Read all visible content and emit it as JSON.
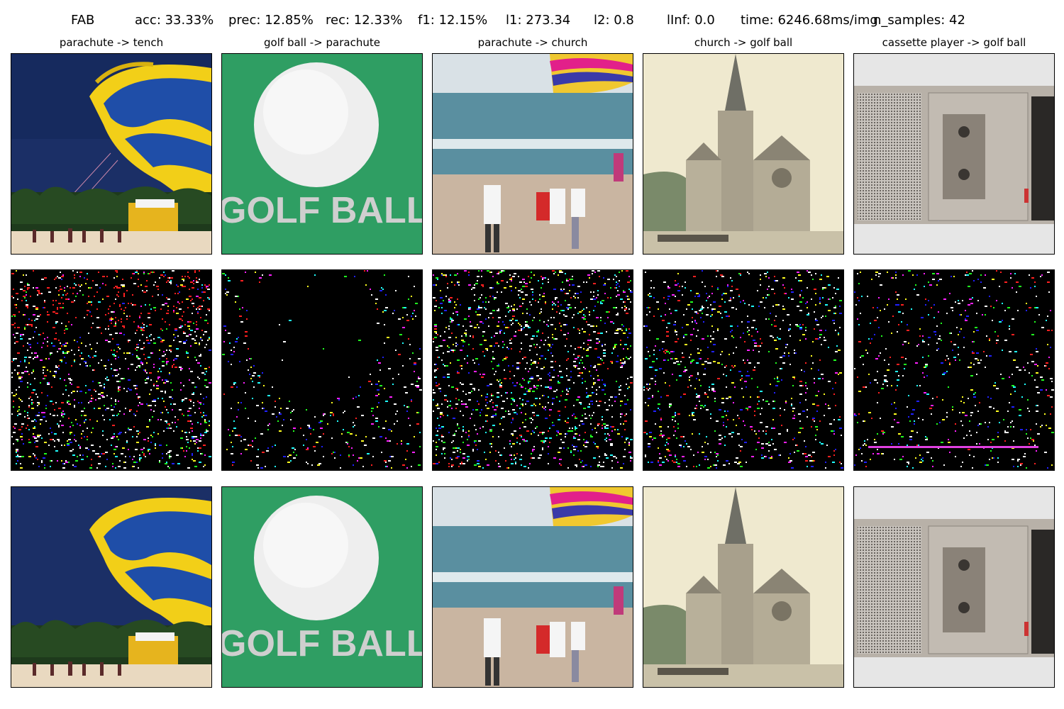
{
  "header": {
    "method": "FAB",
    "acc": "acc: 33.33%",
    "prec": "prec: 12.85%",
    "rec": "rec: 12.33%",
    "f1": "f1: 12.15%",
    "l1": "l1: 273.34",
    "l2": "l2: 0.8",
    "linf": "lInf: 0.0",
    "time": "time: 6246.68ms/img",
    "n_samples": "n_samples: 42"
  },
  "columns": [
    {
      "title": "parachute -> tench"
    },
    {
      "title": "golf ball -> parachute"
    },
    {
      "title": "parachute -> church"
    },
    {
      "title": "church -> golf ball"
    },
    {
      "title": "cassette player -> golf ball"
    }
  ],
  "image_text": {
    "golf_print": "GOLF BALL"
  },
  "colors": {
    "parachute_yellow": "#f2cf18",
    "parachute_blue": "#1f4ea8",
    "sky_blue": "#1b2f66",
    "golf_green": "#2f9e63",
    "ocean": "#5a8fa0",
    "church_paper": "#efe9cf",
    "cassette_bg": "#e6e6e6"
  }
}
